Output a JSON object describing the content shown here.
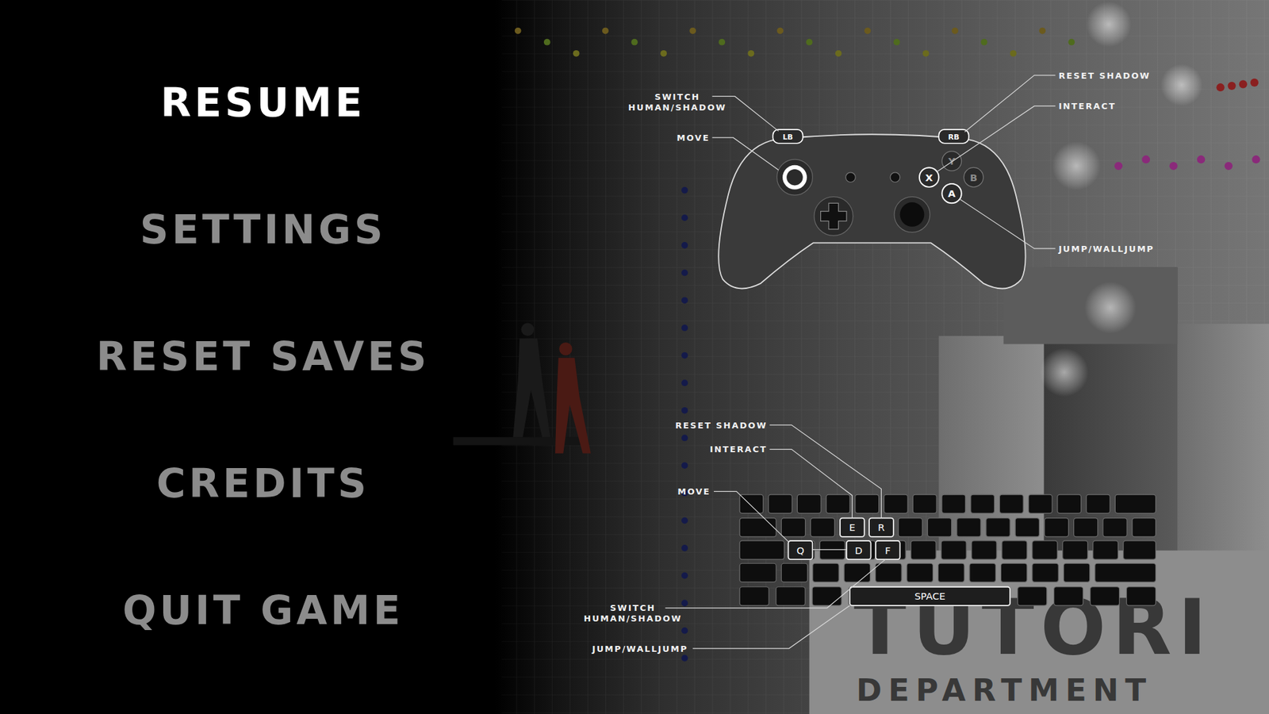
{
  "menu": [
    {
      "label": "RESUME",
      "selected": true
    },
    {
      "label": "SETTINGS",
      "selected": false
    },
    {
      "label": "RESET SAVES",
      "selected": false
    },
    {
      "label": "CREDITS",
      "selected": false
    },
    {
      "label": "QUIT GAME",
      "selected": false
    }
  ],
  "controller": {
    "buttons": [
      {
        "label": "LB",
        "highlighted": true
      },
      {
        "label": "RB",
        "highlighted": true
      },
      {
        "label": "Y",
        "highlighted": false
      },
      {
        "label": "X",
        "highlighted": true
      },
      {
        "label": "B",
        "highlighted": false
      },
      {
        "label": "A",
        "highlighted": true
      }
    ],
    "callouts": [
      {
        "lines": [
          "SWITCH",
          "HUMAN/SHADOW"
        ]
      },
      {
        "lines": [
          "MOVE"
        ]
      },
      {
        "lines": [
          "RESET SHADOW"
        ]
      },
      {
        "lines": [
          "INTERACT"
        ]
      },
      {
        "lines": [
          "JUMP/WALLJUMP"
        ]
      }
    ]
  },
  "keyboard": {
    "keys": [
      {
        "label": "E"
      },
      {
        "label": "R"
      },
      {
        "label": "Q"
      },
      {
        "label": "D"
      },
      {
        "label": "F"
      },
      {
        "label": "SPACE"
      }
    ],
    "callouts": [
      {
        "lines": [
          "RESET SHADOW"
        ]
      },
      {
        "lines": [
          "INTERACT"
        ]
      },
      {
        "lines": [
          "MOVE"
        ]
      },
      {
        "lines": [
          "SWITCH",
          "HUMAN/SHADOW"
        ]
      },
      {
        "lines": [
          "JUMP/WALLJUMP"
        ]
      }
    ]
  },
  "scene_sign": {
    "title": "TUTORI",
    "subtitle": "DEPARTMENT"
  }
}
